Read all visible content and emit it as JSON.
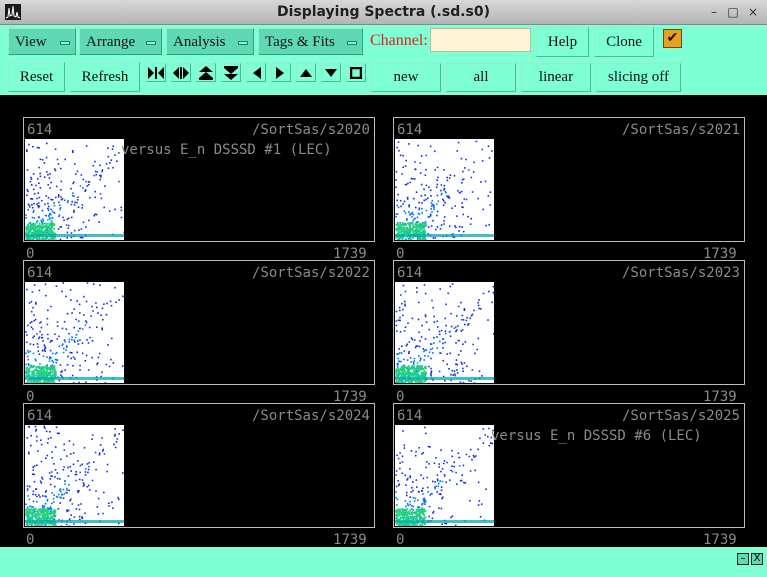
{
  "window": {
    "title": "Displaying Spectra (.sd.s0)",
    "minimize": "–",
    "maximize": "□",
    "close": "×"
  },
  "menus": [
    {
      "label": "View"
    },
    {
      "label": "Arrange"
    },
    {
      "label": "Analysis"
    },
    {
      "label": "Tags & Fits"
    }
  ],
  "channel": {
    "label": "Channel:",
    "value": ""
  },
  "buttons": {
    "help": "Help",
    "clone": "Clone",
    "reset": "Reset",
    "refresh": "Refresh",
    "new": "new",
    "all": "all",
    "linear": "linear",
    "slicing": "slicing off",
    "checkbox": "✔"
  },
  "nav_icons": [
    "expand-horizontal-icon",
    "compress-horizontal-icon",
    "expand-vertical-icon",
    "compress-vertical-icon",
    "scroll-left-icon",
    "scroll-right-icon",
    "scroll-up-icon",
    "scroll-down-icon",
    "full-view-icon"
  ],
  "panels": [
    {
      "name": "/SortSas/s2020",
      "ymax": "614",
      "xmin": "0",
      "xmax": "1739",
      "title": "Q versus E_n DSSSD #1 (LEC)",
      "title_visible": "versus E_n DSSSD #1 (LEC)"
    },
    {
      "name": "/SortSas/s2021",
      "ymax": "614",
      "xmin": "0",
      "xmax": "1739",
      "title": "",
      "title_visible": ""
    },
    {
      "name": "/SortSas/s2022",
      "ymax": "614",
      "xmin": "0",
      "xmax": "1739",
      "title": "",
      "title_visible": ""
    },
    {
      "name": "/SortSas/s2023",
      "ymax": "614",
      "xmin": "0",
      "xmax": "1739",
      "title": "",
      "title_visible": ""
    },
    {
      "name": "/SortSas/s2024",
      "ymax": "614",
      "xmin": "0",
      "xmax": "1739",
      "title": "",
      "title_visible": ""
    },
    {
      "name": "/SortSas/s2025",
      "ymax": "614",
      "xmin": "0",
      "xmax": "1739",
      "title": "Q versus E_n DSSSD #6 (LEC)",
      "title_visible": "versus E_n DSSSD #6 (LEC)"
    }
  ],
  "statusbar": {
    "minimize": "–",
    "close": "X"
  },
  "colors": {
    "toolbar": "#7fffd4",
    "menu": "#5fd9b4",
    "channel_label": "#e02020",
    "display_bg": "#000000",
    "text_dim": "#8a8a8a"
  }
}
